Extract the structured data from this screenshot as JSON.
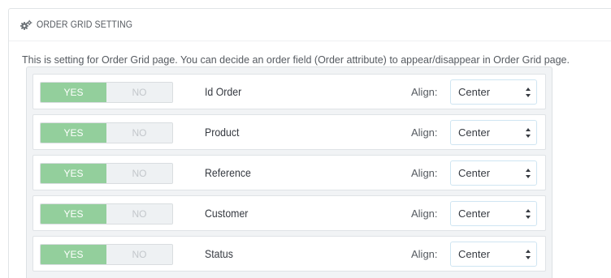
{
  "panel": {
    "title": "ORDER GRID SETTING",
    "icon": "cogs-icon",
    "description": "This is setting for Order Grid page. You can decide an order field (Order attribute) to appear/disappear in Order Grid page."
  },
  "toggle": {
    "yes_label": "YES",
    "no_label": "NO"
  },
  "colors": {
    "yes_active": "#93cf9c",
    "select_border": "#cfe5f2"
  },
  "fields": [
    {
      "name": "Id Order",
      "enabled": true,
      "align_label": "Align:",
      "align_value": "Center"
    },
    {
      "name": "Product",
      "enabled": true,
      "align_label": "Align:",
      "align_value": "Center"
    },
    {
      "name": "Reference",
      "enabled": true,
      "align_label": "Align:",
      "align_value": "Center"
    },
    {
      "name": "Customer",
      "enabled": true,
      "align_label": "Align:",
      "align_value": "Center"
    },
    {
      "name": "Status",
      "enabled": true,
      "align_label": "Align:",
      "align_value": "Center"
    }
  ]
}
